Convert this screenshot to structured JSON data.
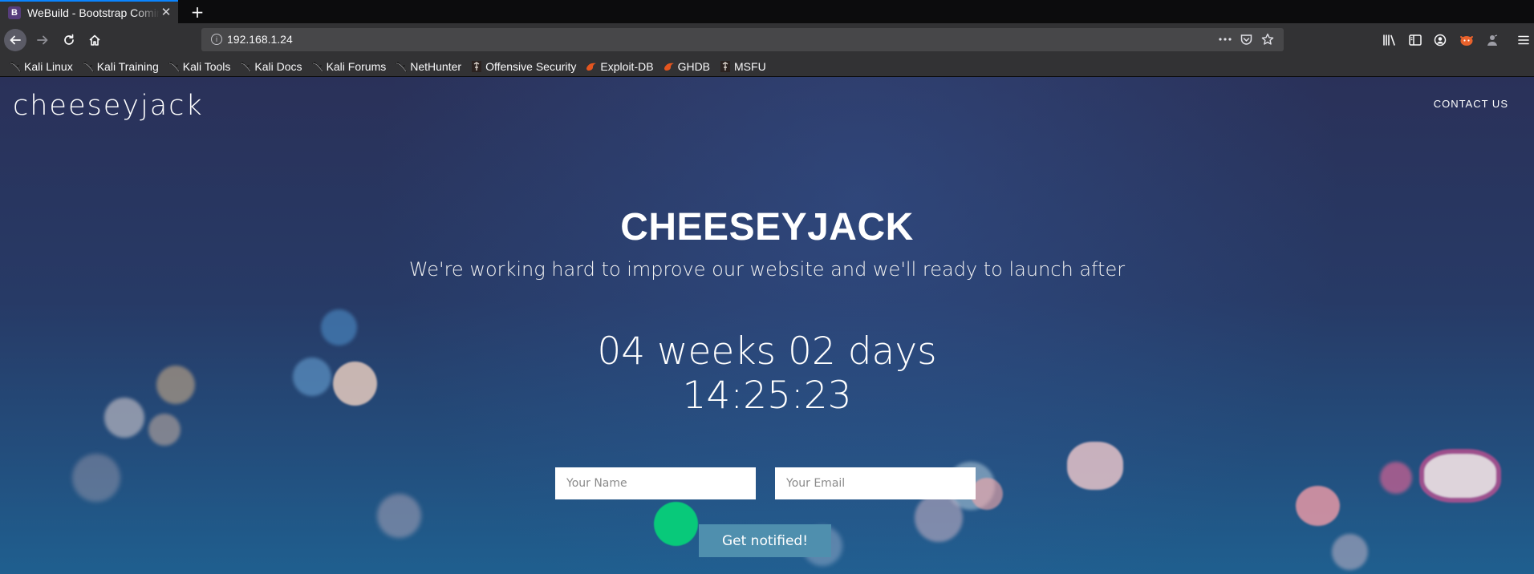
{
  "browser": {
    "tab_title": "WeBuild - Bootstrap Coming Soon",
    "tab_favicon_letter": "B",
    "url": "192.168.1.24"
  },
  "bookmarks": [
    {
      "label": "Kali Linux",
      "icon": "kali-dragon-icon"
    },
    {
      "label": "Kali Training",
      "icon": "kali-dragon-icon"
    },
    {
      "label": "Kali Tools",
      "icon": "kali-dragon-icon"
    },
    {
      "label": "Kali Docs",
      "icon": "kali-dragon-icon"
    },
    {
      "label": "Kali Forums",
      "icon": "kali-dragon-icon"
    },
    {
      "label": "NetHunter",
      "icon": "kali-dragon-icon"
    },
    {
      "label": "Offensive Security",
      "icon": "offsec-icon"
    },
    {
      "label": "Exploit-DB",
      "icon": "exploitdb-icon"
    },
    {
      "label": "GHDB",
      "icon": "exploitdb-icon"
    },
    {
      "label": "MSFU",
      "icon": "offsec-icon"
    }
  ],
  "site": {
    "brand": "cheeseyjack",
    "nav_contact": "CONTACT US",
    "title": "CHEESEYJACK",
    "subtitle": "We're working hard to improve our website and we'll ready to launch after",
    "countdown_line1": "04 weeks 02 days",
    "countdown_line2": "14:25:23",
    "name_placeholder": "Your Name",
    "email_placeholder": "Your Email",
    "notify_label": "Get notified!"
  }
}
